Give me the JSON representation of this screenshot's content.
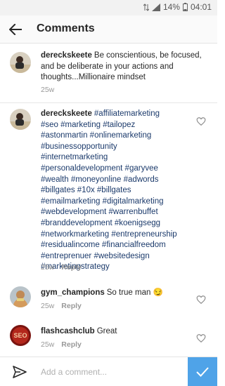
{
  "status_bar": {
    "battery": "14%",
    "time": "04:01"
  },
  "header": {
    "title": "Comments"
  },
  "caption": {
    "username": "dereckskeete",
    "text": "Be conscientious, be focused, and be deliberate in your actions and thoughts...Millionaire mindset",
    "time": "25w"
  },
  "comments": [
    {
      "username": "dereckskeete",
      "lines": [
        "#affiliatemarketing",
        "#seo #marketing #tailopez",
        "#astonmartin #onlinemarketing",
        "#businessopportunity",
        "#internetmarketing",
        "#personaldevelopment #garyvee",
        "#wealth #moneyonline #adwords",
        "#billgates #10x #billgates",
        "#emailmarketing #digitalmarketing",
        "#webdevelopment #warrenbuffet",
        "#branddevelopment #koenigsegg",
        "#networkmarketing #entrepreneurship",
        "#residualincome #financialfreedom",
        "#entreprenuer #websitedesign",
        "#marketingstrategy"
      ],
      "time": "25w",
      "reply": "Reply"
    },
    {
      "username": "gym_champions",
      "text": "So true man 😏",
      "time": "25w",
      "reply": "Reply"
    },
    {
      "username": "flashcashclub",
      "text": "Great",
      "time": "25w",
      "reply": "Reply"
    }
  ],
  "input": {
    "placeholder": "Add a comment..."
  },
  "avatar_badge_text": "SEO",
  "colors": {
    "accent": "#4fa3e8",
    "hashtag": "#1b3a6b"
  },
  "icons": [
    "back-arrow-icon",
    "heart-icon",
    "send-icon",
    "check-icon"
  ]
}
